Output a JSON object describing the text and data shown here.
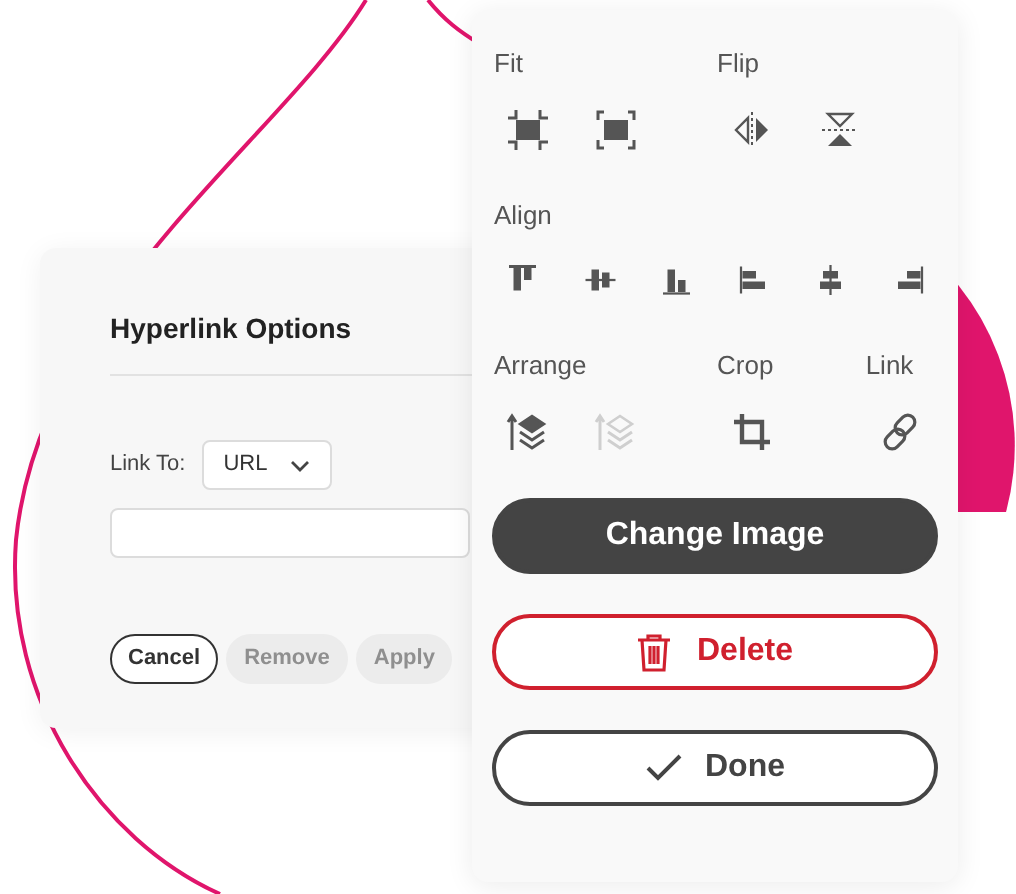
{
  "hyperlink_dialog": {
    "title": "Hyperlink Options",
    "link_to_label": "Link To:",
    "link_to_value": "URL",
    "buttons": [
      {
        "label": "Cancel",
        "disabled": false
      },
      {
        "label": "Remove",
        "disabled": true
      },
      {
        "label": "Apply",
        "disabled": true
      }
    ]
  },
  "image_panel": {
    "rows": [
      [
        {
          "label": "Fit",
          "tools": [
            {
              "kind": "fit",
              "disabled": false
            },
            {
              "kind": "fill",
              "disabled": false
            }
          ]
        },
        {
          "label": "Flip",
          "tools": [
            {
              "kind": "flip-horizontal",
              "disabled": false
            },
            {
              "kind": "flip-vertical",
              "disabled": false
            }
          ]
        }
      ],
      [
        {
          "label": "Align",
          "tools": [
            {
              "kind": "align-top",
              "disabled": false
            },
            {
              "kind": "align-middle",
              "disabled": false
            },
            {
              "kind": "align-bottom",
              "disabled": false
            },
            {
              "kind": "align-left",
              "disabled": false
            },
            {
              "kind": "align-center",
              "disabled": false
            },
            {
              "kind": "align-right",
              "disabled": false
            }
          ]
        }
      ],
      [
        {
          "label": "Arrange",
          "tools": [
            {
              "kind": "bring-forward",
              "disabled": false
            },
            {
              "kind": "send-backward",
              "disabled": true
            }
          ]
        },
        {
          "label": "Crop",
          "tools": [
            {
              "kind": "crop",
              "disabled": false
            }
          ]
        },
        {
          "label": "Link",
          "tools": [
            {
              "kind": "link",
              "disabled": false
            }
          ]
        }
      ]
    ],
    "actions": [
      {
        "label": "Change Image",
        "kind": "primary"
      },
      {
        "label": "Delete",
        "kind": "danger"
      },
      {
        "label": "Done",
        "kind": "confirm"
      }
    ]
  }
}
